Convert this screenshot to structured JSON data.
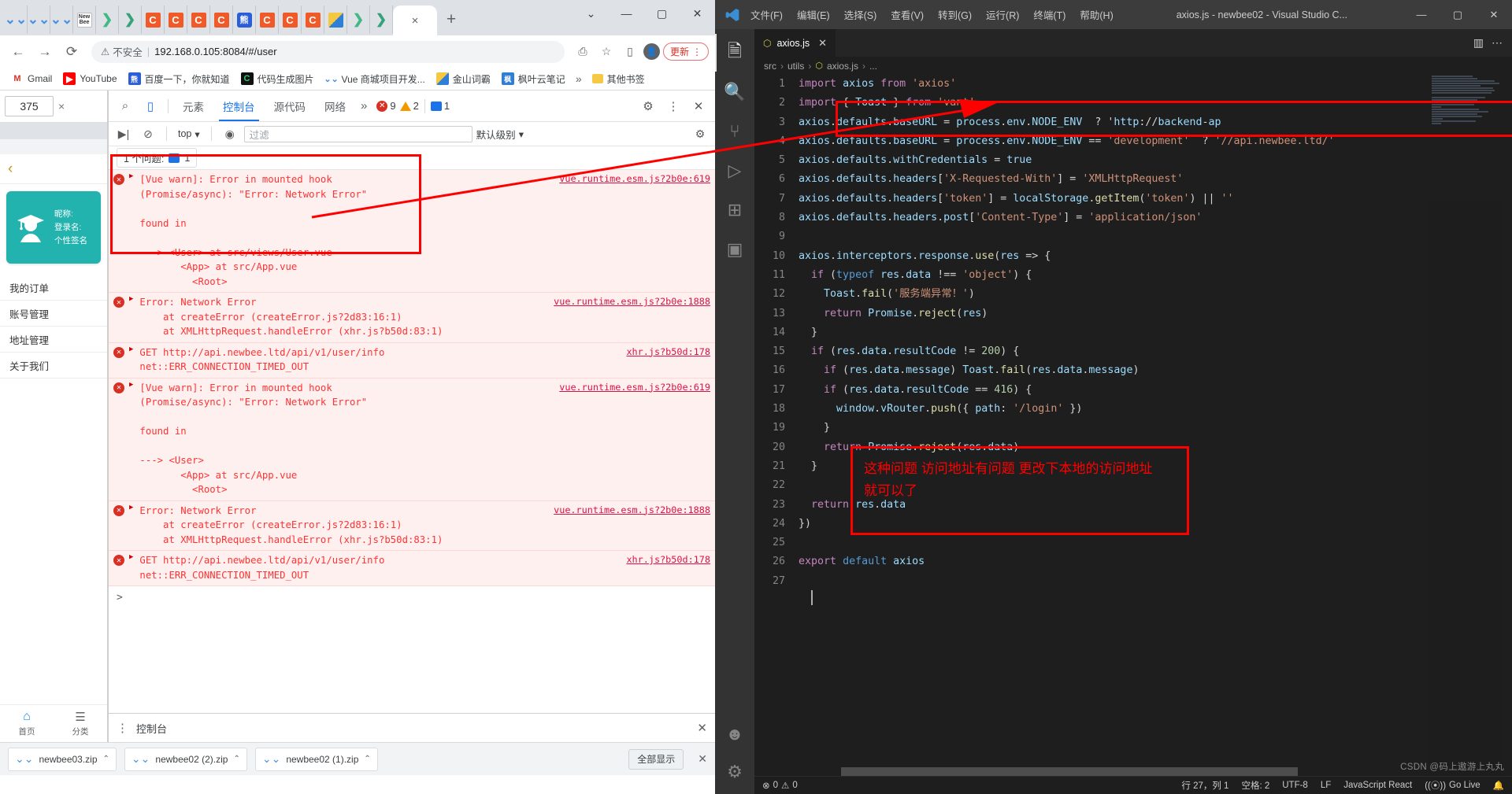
{
  "browser": {
    "tabs_icons": [
      "dl",
      "dl",
      "dl",
      "newbee",
      "vue",
      "vue",
      "c",
      "c",
      "c",
      "c",
      "baidu",
      "c",
      "c",
      "c",
      "img",
      "vue",
      "vue"
    ],
    "active_tab_label": "×",
    "newtab_label": "+",
    "window_controls": {
      "minimize": "—",
      "maximize": "▢",
      "close": "✕",
      "chevron": "⌄"
    },
    "nav": {
      "back": "←",
      "forward": "→",
      "reload": "⟳"
    },
    "omnibox": {
      "warning_icon": "⚠",
      "warning_text": "不安全",
      "url": "192.168.0.105:8084/#/user",
      "share_icon": "⎙",
      "star_icon": "☆"
    },
    "toolbar_right": {
      "ext_icon": "▯",
      "profile_icon": "●",
      "update_label": "更新",
      "menu_icon": "⋮"
    },
    "bookmarks": [
      {
        "label": "Gmail",
        "icon": "M",
        "color": "#d93025"
      },
      {
        "label": "YouTube",
        "icon": "▶",
        "color": "#ff0000"
      },
      {
        "label": "百度一下，你就知道",
        "icon": "熊",
        "color": "#2b5fd9"
      },
      {
        "label": "代码生成图片",
        "icon": "C",
        "color": "#111111"
      },
      {
        "label": "Vue 商城项目开发...",
        "icon": "❯",
        "color": "#42b883"
      },
      {
        "label": "金山词霸",
        "icon": "金",
        "color": "#e8a33d"
      },
      {
        "label": "枫叶云笔记",
        "icon": "枫",
        "color": "#2f7fd6"
      }
    ],
    "bookmarks_overflow": "»",
    "bookmarks_folder": "其他书签"
  },
  "device_toolbar": {
    "width_value": "375",
    "clear_label": "×"
  },
  "mobile_page": {
    "back_chevron": "‹",
    "user_card": {
      "line1": "昵称:",
      "line2": "登录名:",
      "line3": "个性签名"
    },
    "menu": [
      "我的订单",
      "账号管理",
      "地址管理",
      "关于我们"
    ],
    "tabbar": [
      {
        "icon": "⌂",
        "label": "首页"
      },
      {
        "icon": "▤",
        "label": "分类"
      }
    ]
  },
  "devtools": {
    "inspect_icon": "⌕",
    "device_icon": "▯",
    "tabs": [
      "元素",
      "控制台",
      "源代码",
      "网络"
    ],
    "active_tab": "控制台",
    "overflow": "»",
    "badges": {
      "errors": "9",
      "warnings": "2",
      "messages": "1"
    },
    "settings_icon": "⚙",
    "more_icon": "⋮",
    "close_icon": "✕",
    "console_bar": {
      "sidebar_icon": "▶|",
      "clear_icon": "⊘",
      "context": "top",
      "eye_icon": "◉",
      "filter_placeholder": "过滤",
      "level": "默认级别",
      "settings_icon": "⚙"
    },
    "issues_bar": {
      "text": "1 个问题:",
      "count": "1"
    },
    "logs": [
      {
        "text": "[Vue warn]: Error in mounted hook\n(Promise/async): \"Error: Network Error\"\n\nfound in\n\n---> <User> at src/views/User.vue\n       <App> at src/App.vue\n         <Root>",
        "source": "vue.runtime.esm.js?2b0e:619"
      },
      {
        "text": "Error: Network Error\n    at createError (createError.js?2d83:16:1)\n    at XMLHttpRequest.handleError (xhr.js?b50d:83:1)",
        "source": "vue.runtime.esm.js?2b0e:1888"
      },
      {
        "text": "GET http://api.newbee.ltd/api/v1/user/info\nnet::ERR_CONNECTION_TIMED_OUT",
        "source": "xhr.js?b50d:178"
      },
      {
        "text": "[Vue warn]: Error in mounted hook\n(Promise/async): \"Error: Network Error\"\n\nfound in\n\n---> <User>\n       <App> at src/App.vue\n         <Root>",
        "source": "vue.runtime.esm.js?2b0e:619"
      },
      {
        "text": "Error: Network Error\n    at createError (createError.js?2d83:16:1)\n    at XMLHttpRequest.handleError (xhr.js?b50d:83:1)",
        "source": "vue.runtime.esm.js?2b0e:1888"
      },
      {
        "text": "GET http://api.newbee.ltd/api/v1/user/info\nnet::ERR_CONNECTION_TIMED_OUT",
        "source": "xhr.js?b50d:178"
      }
    ],
    "prompt": ">",
    "drawer": {
      "dots": "⋮",
      "title": "控制台",
      "close": "✕"
    }
  },
  "downloads": [
    {
      "name": "newbee03.zip",
      "caret": "⌃"
    },
    {
      "name": "newbee02 (2).zip",
      "caret": "⌃"
    },
    {
      "name": "newbee02 (1).zip",
      "caret": "⌃"
    }
  ],
  "downloads_show_all": "全部显示",
  "downloads_close": "✕",
  "vscode": {
    "menus": [
      "文件(F)",
      "编辑(E)",
      "选择(S)",
      "查看(V)",
      "转到(G)",
      "运行(R)",
      "终端(T)",
      "帮助(H)"
    ],
    "title": "axios.js - newbee02 - Visual Studio C...",
    "window_controls": {
      "minimize": "—",
      "maximize": "▢",
      "close": "✕"
    },
    "activity_icons": [
      "files-icon",
      "search-icon",
      "source-control-icon",
      "run-debug-icon",
      "extensions-icon",
      "remote-icon",
      "account-icon",
      "settings-icon"
    ],
    "tab": {
      "label": "axios.js",
      "close": "✕"
    },
    "tab_actions": {
      "split": "▥",
      "more": "⋯"
    },
    "breadcrumb": [
      "src",
      "utils",
      "axios.js",
      "..."
    ],
    "code_lines": [
      {
        "n": "1",
        "text": "import axios from 'axios'"
      },
      {
        "n": "2",
        "text": "import { Toast } from 'vant'"
      },
      {
        "n": "3",
        "text": "axios.defaults.baseURL = process.env.NODE_ENV  ? 'http://backend-ap"
      },
      {
        "n": "4",
        "text": "axios.defaults.baseURL = process.env.NODE_ENV == 'development'  ? '//api.newbee.ltd/'"
      },
      {
        "n": "5",
        "text": "axios.defaults.withCredentials = true"
      },
      {
        "n": "6",
        "text": "axios.defaults.headers['X-Requested-With'] = 'XMLHttpRequest'"
      },
      {
        "n": "7",
        "text": "axios.defaults.headers['token'] = localStorage.getItem('token') || ''"
      },
      {
        "n": "8",
        "text": "axios.defaults.headers.post['Content-Type'] = 'application/json'"
      },
      {
        "n": "9",
        "text": ""
      },
      {
        "n": "10",
        "text": "axios.interceptors.response.use(res => {"
      },
      {
        "n": "11",
        "text": "  if (typeof res.data !== 'object') {"
      },
      {
        "n": "12",
        "text": "    Toast.fail('服务端异常！')"
      },
      {
        "n": "13",
        "text": "    return Promise.reject(res)"
      },
      {
        "n": "14",
        "text": "  }"
      },
      {
        "n": "15",
        "text": "  if (res.data.resultCode != 200) {"
      },
      {
        "n": "16",
        "text": "    if (res.data.message) Toast.fail(res.data.message)"
      },
      {
        "n": "17",
        "text": "    if (res.data.resultCode == 416) {"
      },
      {
        "n": "18",
        "text": "      window.vRouter.push({ path: '/login' })"
      },
      {
        "n": "19",
        "text": "    }"
      },
      {
        "n": "20",
        "text": "    return Promise.reject(res.data)"
      },
      {
        "n": "21",
        "text": "  }"
      },
      {
        "n": "22",
        "text": ""
      },
      {
        "n": "23",
        "text": "  return res.data"
      },
      {
        "n": "24",
        "text": "})"
      },
      {
        "n": "25",
        "text": ""
      },
      {
        "n": "26",
        "text": "export default axios"
      },
      {
        "n": "27",
        "text": ""
      }
    ],
    "status_bar": {
      "errors": "0",
      "warnings": "0",
      "position": "行 27，列 1",
      "indent": "空格: 2",
      "encoding": "UTF-8",
      "eol": "LF",
      "language": "JavaScript React",
      "live": "Go Live",
      "bell": "🔔"
    },
    "watermark": "CSDN @码上遨游上丸丸"
  },
  "annotations": {
    "note_text": "这种问题 访问地址有问题 更改下本地的访问地址\n就可以了",
    "color": "#ff0000"
  }
}
